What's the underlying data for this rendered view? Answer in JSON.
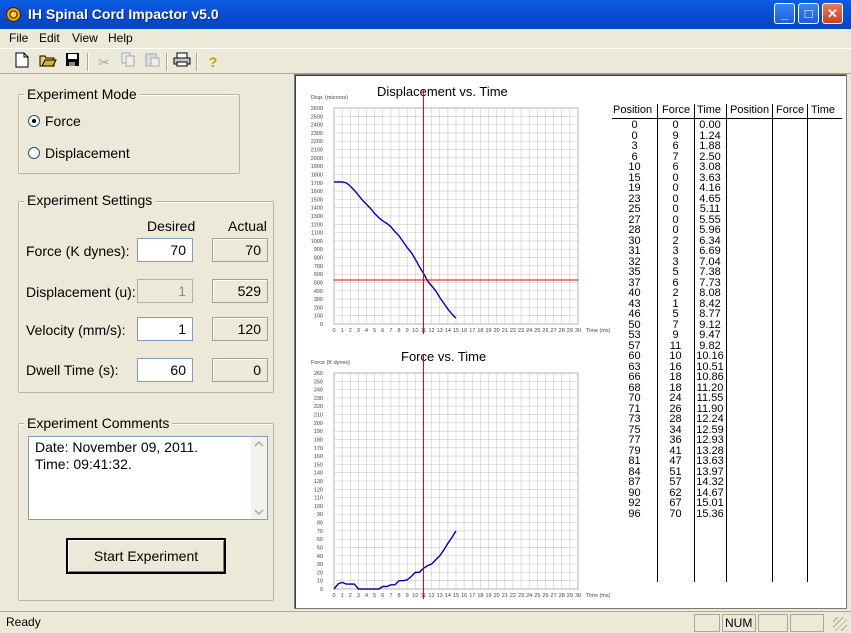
{
  "window": {
    "title": "IH Spinal Cord Impactor v5.0",
    "min": "_",
    "max": "□",
    "close": "✕"
  },
  "menu": [
    "File",
    "Edit",
    "View",
    "Help"
  ],
  "toolbar": {
    "icons": [
      "new-file-icon",
      "open-folder-icon",
      "save-icon",
      "cut-icon",
      "copy-icon",
      "paste-icon",
      "print-icon",
      "help-icon"
    ]
  },
  "mode": {
    "label": "Experiment Mode",
    "force": "Force",
    "displacement": "Displacement",
    "selected": "Force"
  },
  "settings": {
    "label": "Experiment Settings",
    "desired": "Desired",
    "actual": "Actual",
    "force": {
      "label": "Force (K dynes):",
      "desired": "70",
      "actual": "70"
    },
    "displacement": {
      "label": "Displacement (u):",
      "desired": "1",
      "actual": "529"
    },
    "velocity": {
      "label": "Velocity (mm/s):",
      "desired": "1",
      "actual": "120"
    },
    "dwell": {
      "label": "Dwell Time (s):",
      "desired": "60",
      "actual": "0"
    }
  },
  "comments": {
    "label": "Experiment Comments",
    "line1": "Date: November 09, 2011.",
    "line2": "Time: 09:41:32."
  },
  "start_button": "Start Experiment",
  "status": {
    "text": "Ready",
    "num": "NUM"
  },
  "colors": {
    "curve": "#0000b0",
    "cursor": "#e00000",
    "grid": "#c8c8c8"
  },
  "chart_data": [
    {
      "type": "line",
      "title": "Displacement vs. Time",
      "ylabel": "Disp. (microns)",
      "xlabel": "Time (ms)",
      "xlim": [
        0,
        30
      ],
      "ylim": [
        0,
        2600
      ],
      "ytick_step": 100,
      "xtick_step": 1,
      "cursor": {
        "x": 11,
        "y": 529
      },
      "series": [
        {
          "x": [
            0,
            1,
            1.5,
            2,
            2.5,
            3,
            3.5,
            4,
            4.5,
            5,
            5.5,
            6,
            6.5,
            7,
            7.5,
            8,
            8.5,
            9,
            9.5,
            10,
            10.5,
            11,
            11.5,
            12,
            12.5,
            13,
            13.5,
            14,
            14.5,
            15
          ],
          "y": [
            1710,
            1710,
            1700,
            1660,
            1610,
            1550,
            1490,
            1440,
            1390,
            1330,
            1280,
            1240,
            1210,
            1170,
            1110,
            1060,
            990,
            920,
            860,
            780,
            690,
            610,
            520,
            460,
            400,
            320,
            250,
            180,
            120,
            70
          ]
        }
      ]
    },
    {
      "type": "line",
      "title": "Force vs. Time",
      "ylabel": "Force (K dynes)",
      "xlabel": "Time (ms)",
      "xlim": [
        0,
        30
      ],
      "ylim": [
        0,
        260
      ],
      "ytick_step": 10,
      "xtick_step": 1,
      "cursor": {
        "x": 11
      },
      "series": [
        {
          "x": [
            0,
            0.5,
            1,
            1.5,
            2,
            2.5,
            3,
            3.5,
            4,
            4.5,
            5,
            5.5,
            6,
            6.5,
            7,
            7.5,
            8,
            8.5,
            9,
            9.5,
            10,
            10.5,
            11,
            11.5,
            12,
            12.5,
            13,
            13.5,
            14,
            14.5,
            15
          ],
          "y": [
            0,
            6,
            8,
            6,
            6,
            6,
            0,
            0,
            0,
            0,
            0,
            0,
            3,
            3,
            5,
            5,
            10,
            10,
            11,
            15,
            20,
            20,
            25,
            28,
            30,
            35,
            40,
            47,
            55,
            62,
            70
          ]
        }
      ]
    },
    {
      "type": "table",
      "columns": [
        "Position",
        "Force",
        "Time",
        "Position",
        "Force",
        "Time"
      ],
      "rows": [
        [
          "0",
          "0",
          "0.00"
        ],
        [
          "0",
          "9",
          "1.24"
        ],
        [
          "3",
          "6",
          "1.88"
        ],
        [
          "6",
          "7",
          "2.50"
        ],
        [
          "10",
          "6",
          "3.08"
        ],
        [
          "15",
          "0",
          "3.63"
        ],
        [
          "19",
          "0",
          "4.16"
        ],
        [
          "23",
          "0",
          "4.65"
        ],
        [
          "25",
          "0",
          "5.11"
        ],
        [
          "27",
          "0",
          "5.55"
        ],
        [
          "28",
          "0",
          "5.96"
        ],
        [
          "30",
          "2",
          "6.34"
        ],
        [
          "31",
          "3",
          "6.69"
        ],
        [
          "32",
          "3",
          "7.04"
        ],
        [
          "35",
          "5",
          "7.38"
        ],
        [
          "37",
          "6",
          "7.73"
        ],
        [
          "40",
          "2",
          "8.08"
        ],
        [
          "43",
          "1",
          "8.42"
        ],
        [
          "46",
          "5",
          "8.77"
        ],
        [
          "50",
          "7",
          "9.12"
        ],
        [
          "53",
          "9",
          "9.47"
        ],
        [
          "57",
          "11",
          "9.82"
        ],
        [
          "60",
          "10",
          "10.16"
        ],
        [
          "63",
          "16",
          "10.51"
        ],
        [
          "66",
          "18",
          "10.86"
        ],
        [
          "68",
          "18",
          "11.20"
        ],
        [
          "70",
          "24",
          "11.55"
        ],
        [
          "71",
          "26",
          "11.90"
        ],
        [
          "73",
          "28",
          "12.24"
        ],
        [
          "75",
          "34",
          "12.59"
        ],
        [
          "77",
          "36",
          "12.93"
        ],
        [
          "79",
          "41",
          "13.28"
        ],
        [
          "81",
          "47",
          "13.63"
        ],
        [
          "84",
          "51",
          "13.97"
        ],
        [
          "87",
          "57",
          "14.32"
        ],
        [
          "90",
          "62",
          "14.67"
        ],
        [
          "92",
          "67",
          "15.01"
        ],
        [
          "96",
          "70",
          "15.36"
        ]
      ]
    }
  ]
}
